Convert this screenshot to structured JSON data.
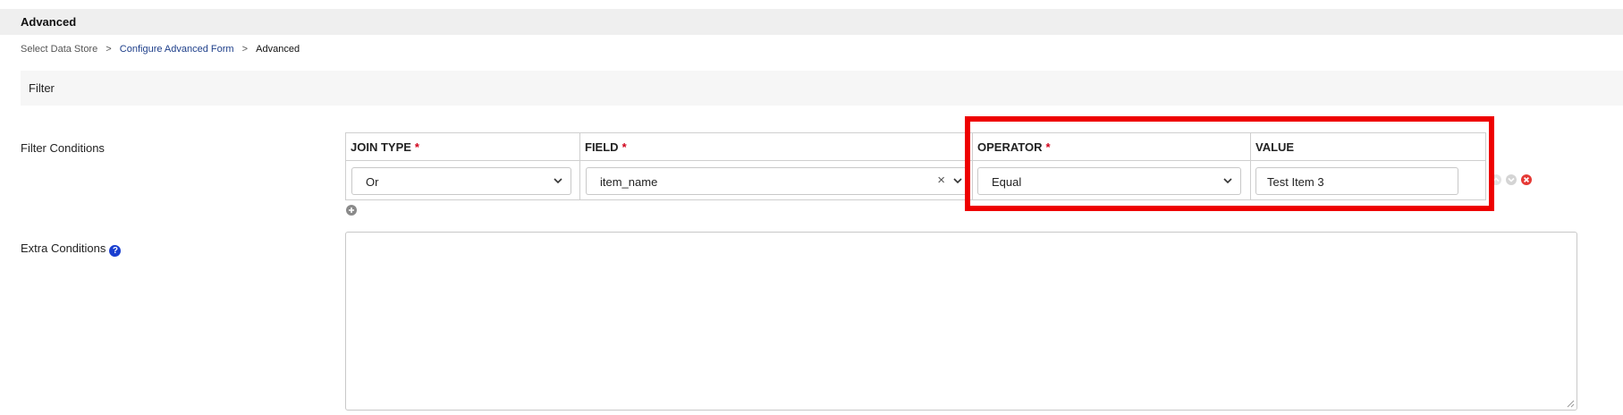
{
  "header": {
    "title": "Advanced"
  },
  "breadcrumb": {
    "items": [
      {
        "label": "Select Data Store"
      },
      {
        "label": "Configure Advanced Form"
      },
      {
        "label": "Advanced"
      }
    ],
    "separator": ">"
  },
  "section": {
    "title": "Filter"
  },
  "filter_conditions": {
    "label": "Filter Conditions",
    "required_marker": "*",
    "columns": [
      {
        "label": "JOIN TYPE",
        "required": true
      },
      {
        "label": "FIELD",
        "required": true
      },
      {
        "label": "OPERATOR",
        "required": true
      },
      {
        "label": "VALUE",
        "required": false
      }
    ],
    "rows": [
      {
        "join_type": "Or",
        "field": "item_name",
        "field_clear": "×",
        "operator": "Equal",
        "value": "Test Item 3"
      }
    ],
    "row_action_icons": [
      "move-up-icon",
      "move-down-icon",
      "remove-icon"
    ],
    "add_icon": "plus-circle-icon"
  },
  "extra_conditions": {
    "label": "Extra Conditions",
    "help_icon": "question-circle-icon",
    "help_glyph": "?",
    "value": ""
  },
  "colors": {
    "highlight": "#ee0000",
    "link": "#1e3f8a",
    "required": "#d0021b",
    "help": "#1a3fd0",
    "remove": "#e53935"
  }
}
